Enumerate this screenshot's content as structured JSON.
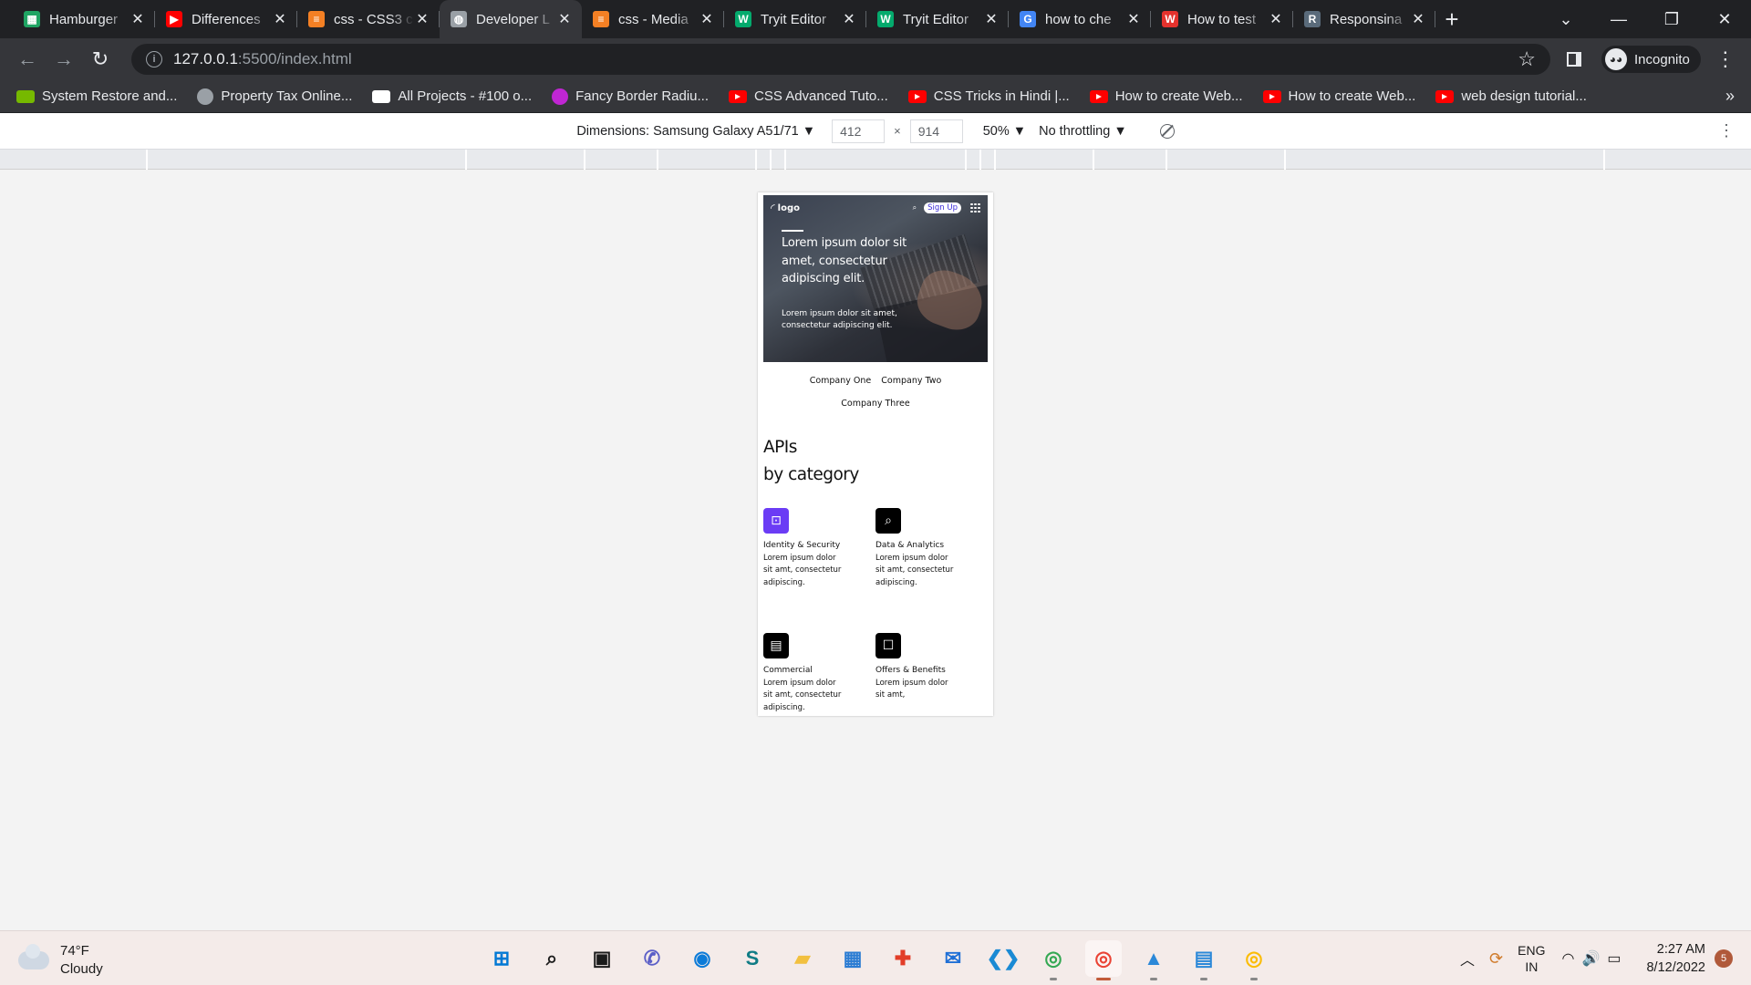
{
  "browser": {
    "tabs": [
      {
        "title": "Hamburger",
        "icon": "sheets-icon",
        "color": "#1fa463",
        "glyph": "▦"
      },
      {
        "title": "Differences",
        "icon": "youtube-icon",
        "color": "#ff0000",
        "glyph": "▶"
      },
      {
        "title": "css - CSS3 c",
        "icon": "stackoverflow-icon",
        "color": "#f48024",
        "glyph": "≡"
      },
      {
        "title": "Developer L",
        "icon": "globe-icon",
        "color": "#9aa0a6",
        "glyph": "◍"
      },
      {
        "title": "css - Media",
        "icon": "stackoverflow-icon",
        "color": "#f48024",
        "glyph": "≡"
      },
      {
        "title": "Tryit Editor",
        "icon": "w3schools-icon",
        "color": "#04aa6d",
        "glyph": "W"
      },
      {
        "title": "Tryit Editor",
        "icon": "w3schools-icon",
        "color": "#04aa6d",
        "glyph": "W"
      },
      {
        "title": "how to che",
        "icon": "google-icon",
        "color": "#4285f4",
        "glyph": "G"
      },
      {
        "title": "How to test",
        "icon": "wikihow-icon",
        "color": "#e5322d",
        "glyph": "W"
      },
      {
        "title": "Responsina",
        "icon": "r-icon",
        "color": "#5a6b7b",
        "glyph": "R"
      }
    ],
    "active_tab_index": 3,
    "tab_close": "✕",
    "new_tab": "+",
    "window_controls": [
      "—",
      "❐",
      "✕"
    ],
    "tab_search": "⌄",
    "url_host": "127.0.0.1",
    "url_path": ":5500/index.html",
    "incognito_label": "Incognito",
    "bookmarks": [
      {
        "label": "System Restore and...",
        "icon": "nvidia-icon",
        "color": "#76b900",
        "kind": "square"
      },
      {
        "label": "Property Tax Online...",
        "icon": "globe-icon",
        "color": "#9aa0a6",
        "kind": "round"
      },
      {
        "label": "All Projects - #100 o...",
        "icon": "codepen-icon",
        "color": "#ffffff",
        "kind": "square"
      },
      {
        "label": "Fancy Border Radiu...",
        "icon": "blob-icon",
        "color": "#c026d3",
        "kind": "round"
      },
      {
        "label": "CSS Advanced Tuto...",
        "icon": "youtube-icon",
        "color": "#ff0000",
        "kind": "yt"
      },
      {
        "label": "CSS Tricks in Hindi |...",
        "icon": "youtube-icon",
        "color": "#ff0000",
        "kind": "yt"
      },
      {
        "label": "How to create Web...",
        "icon": "youtube-icon",
        "color": "#ff0000",
        "kind": "yt"
      },
      {
        "label": "How to create Web...",
        "icon": "youtube-icon",
        "color": "#ff0000",
        "kind": "yt"
      },
      {
        "label": "web design tutorial...",
        "icon": "youtube-icon",
        "color": "#ff0000",
        "kind": "yt"
      }
    ],
    "bookmarks_more": "»"
  },
  "devtools": {
    "dimensions_label": "Dimensions: Samsung Galaxy A51/71 ▼",
    "width": "412",
    "height": "914",
    "times": "×",
    "zoom": "50% ▼",
    "throttling": "No throttling ▼",
    "menu": "⋮"
  },
  "site": {
    "logo_text": "logo",
    "signup": "Sign Up",
    "hero_title": "Lorem ipsum dolor sit amet, consectetur adipiscing elit.",
    "hero_sub": "Lorem ipsum dolor sit amet, consectetur adipiscing elit.",
    "companies": [
      "Company One",
      "Company Two",
      "Company Three"
    ],
    "apis_title_1": "APIs",
    "apis_title_2": "by category",
    "categories": [
      {
        "name": "Identity & Security",
        "desc": "Lorem ipsum dolor sit amt, consectetur adipiscing.",
        "icon": "lock-icon",
        "glyph": "🔒",
        "accent": "#6b3cf5"
      },
      {
        "name": "Data & Analytics",
        "desc": "Lorem ipsum dolor sit amt, consectetur adipiscing.",
        "icon": "magnifier-chart-icon",
        "glyph": "⌕",
        "accent": "#000000"
      },
      {
        "name": "Commercial",
        "desc": "Lorem ipsum dolor sit amt, consectetur adipiscing.",
        "icon": "storefront-icon",
        "glyph": "▤",
        "accent": "#000000"
      },
      {
        "name": "Offers & Benefits",
        "desc": "Lorem ipsum dolor sit amt,",
        "icon": "phone-hand-icon",
        "glyph": "☐",
        "accent": "#000000"
      }
    ]
  },
  "taskbar": {
    "temp": "74°F",
    "weather": "Cloudy",
    "apps": [
      {
        "name": "start-icon",
        "glyph": "⊞",
        "color": "#0078d4"
      },
      {
        "name": "search-icon",
        "glyph": "⌕",
        "color": "#1b1b1b"
      },
      {
        "name": "task-view-icon",
        "glyph": "▣",
        "color": "#1b1b1b"
      },
      {
        "name": "chat-icon",
        "glyph": "✆",
        "color": "#5b5fc7"
      },
      {
        "name": "edge-icon",
        "glyph": "◉",
        "color": "#0c7bd8"
      },
      {
        "name": "sway-icon",
        "glyph": "S",
        "color": "#107c85"
      },
      {
        "name": "file-explorer-icon",
        "glyph": "▰",
        "color": "#f2c03f"
      },
      {
        "name": "store-icon",
        "glyph": "▦",
        "color": "#2b7cd3"
      },
      {
        "name": "gift-icon",
        "glyph": "✚",
        "color": "#e23d28"
      },
      {
        "name": "mail-icon",
        "glyph": "✉",
        "color": "#1f6fd6"
      },
      {
        "name": "vscode-icon",
        "glyph": "❮❯",
        "color": "#1a8ad4"
      },
      {
        "name": "chrome-icon",
        "glyph": "◎",
        "color": "#34a853"
      },
      {
        "name": "chrome-profile-icon",
        "glyph": "◎",
        "color": "#ea4335"
      },
      {
        "name": "photos-icon",
        "glyph": "▲",
        "color": "#2b88d8"
      },
      {
        "name": "notepad-icon",
        "glyph": "▤",
        "color": "#2b88d8"
      },
      {
        "name": "chrome-profile2-icon",
        "glyph": "◎",
        "color": "#fbbc05"
      }
    ],
    "active_app_index": 12,
    "lang_1": "ENG",
    "lang_2": "IN",
    "time": "2:27 AM",
    "date": "8/12/2022",
    "notifications": "5"
  }
}
